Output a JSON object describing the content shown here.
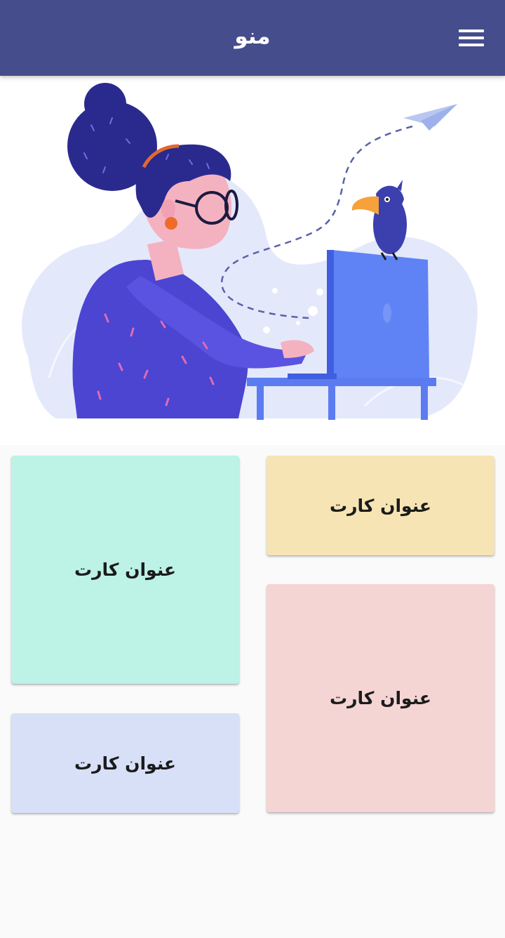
{
  "appbar": {
    "title": "منو"
  },
  "icons": {
    "menu": "hamburger-menu-icon",
    "indicator": "carousel-indicator-dot",
    "illustration": "woman-typing-laptop-with-parrot-illustration"
  },
  "carousel": {
    "page_count": 1,
    "active_index": 0
  },
  "cards": [
    {
      "title": "عنوان کارت",
      "color": "#f6e4b4"
    },
    {
      "title": "عنوان کارت",
      "color": "#bdf2e6"
    },
    {
      "title": "عنوان کارت",
      "color": "#f5d4d4"
    },
    {
      "title": "عنوان کارت",
      "color": "#d7e0f6"
    }
  ],
  "colors": {
    "appbar": "#464d8c",
    "background": "#fafafa"
  }
}
